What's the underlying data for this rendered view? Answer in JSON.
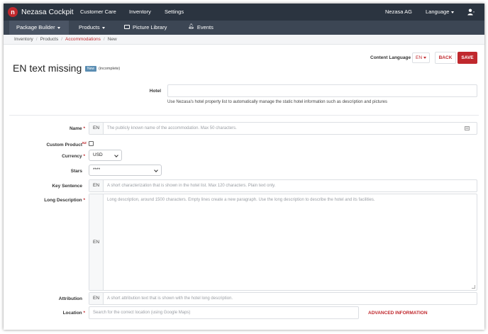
{
  "app": {
    "brand": "Nezasa Cockpit",
    "logo_letter": "n"
  },
  "topnav": {
    "items": [
      "Customer Care",
      "Inventory",
      "Settings"
    ],
    "company": "Nezasa AG",
    "language": "Language"
  },
  "subnav": {
    "items": [
      "Package Builder",
      "Products",
      "Picture Library",
      "Events"
    ]
  },
  "breadcrumb": [
    "Inventory",
    "Products",
    "Accommodations",
    "New"
  ],
  "header": {
    "content_language_label": "Content Language",
    "content_language_value": "EN",
    "back_label": "BACK",
    "save_label": "SAVE",
    "title": "EN text missing",
    "badge": "New",
    "status": "(incomplete)"
  },
  "form": {
    "hotel": {
      "label": "Hotel",
      "value": "",
      "help": "Use Nezasa's hotel property list to automatically manage the static hotel information such as description and pictures"
    },
    "name": {
      "label": "Name",
      "req": "*",
      "lang": "EN",
      "placeholder": "The publicly known name of the accommodation. Max 50 characters."
    },
    "custom_product": {
      "label": "Custom Product",
      "sup": "NZ",
      "checked": false
    },
    "currency": {
      "label": "Currency",
      "req": "*",
      "value": "USD"
    },
    "stars": {
      "label": "Stars",
      "value": "****"
    },
    "key_sentence": {
      "label": "Key Sentence",
      "lang": "EN",
      "placeholder": "A short characterization that is shown in the hotel list. Max 120 characters. Plain text only."
    },
    "long_description": {
      "label": "Long Description",
      "req": "*",
      "lang": "EN",
      "placeholder": "Long description, around 1500 characters. Empty lines create a new paragraph. Use the long description to describe the hotel and its facilities."
    },
    "attribution": {
      "label": "Attribution",
      "lang": "EN",
      "placeholder": "A short attribution text that is shown with the hotel long description."
    },
    "location": {
      "label": "Location",
      "req": "*",
      "placeholder": "Search for the correct location (using Google Maps)",
      "advanced_label": "ADVANCED INFORMATION"
    }
  },
  "colors": {
    "accent": "#c0282d",
    "topnav": "#2b3440",
    "subnav": "#3c4654",
    "badge": "#5b8eb3"
  }
}
